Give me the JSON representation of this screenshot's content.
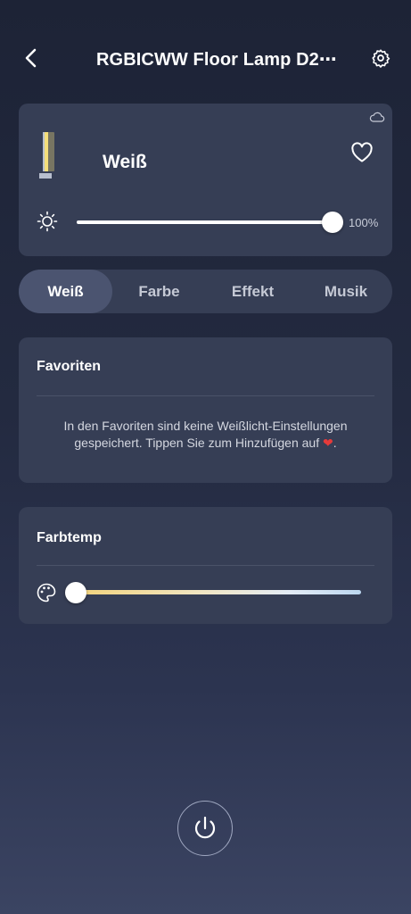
{
  "header": {
    "title": "RGBICWW Floor Lamp D2⋯",
    "back_icon": "chevron-left-icon",
    "settings_icon": "gear-icon"
  },
  "device": {
    "mode_title": "Weiß",
    "brightness": 100,
    "brightness_label": "100%",
    "icons": [
      "cloud-icon",
      "lamp-icon",
      "heart-outline-icon",
      "sun-icon"
    ]
  },
  "tabs": [
    {
      "label": "Weiß",
      "active": true
    },
    {
      "label": "Farbe",
      "active": false
    },
    {
      "label": "Effekt",
      "active": false
    },
    {
      "label": "Musik",
      "active": false
    }
  ],
  "favorites": {
    "title": "Favoriten",
    "empty_text": "In den Favoriten sind keine Weißlicht-Einstellungen gespeichert. Tippen Sie zum Hinzufügen auf",
    "empty_text_end": "."
  },
  "color_temp": {
    "title": "Farbtemp",
    "value_fraction": 0.0,
    "icon": "palette-icon"
  },
  "power": {
    "icon": "power-icon"
  },
  "colors": {
    "background_top": "#1d2336",
    "background_bottom": "#3b4462",
    "card": "#363e55",
    "active_tab": "#4b5470",
    "heart_red": "#e53a3a",
    "lamp_glow": "#f4de7a"
  }
}
